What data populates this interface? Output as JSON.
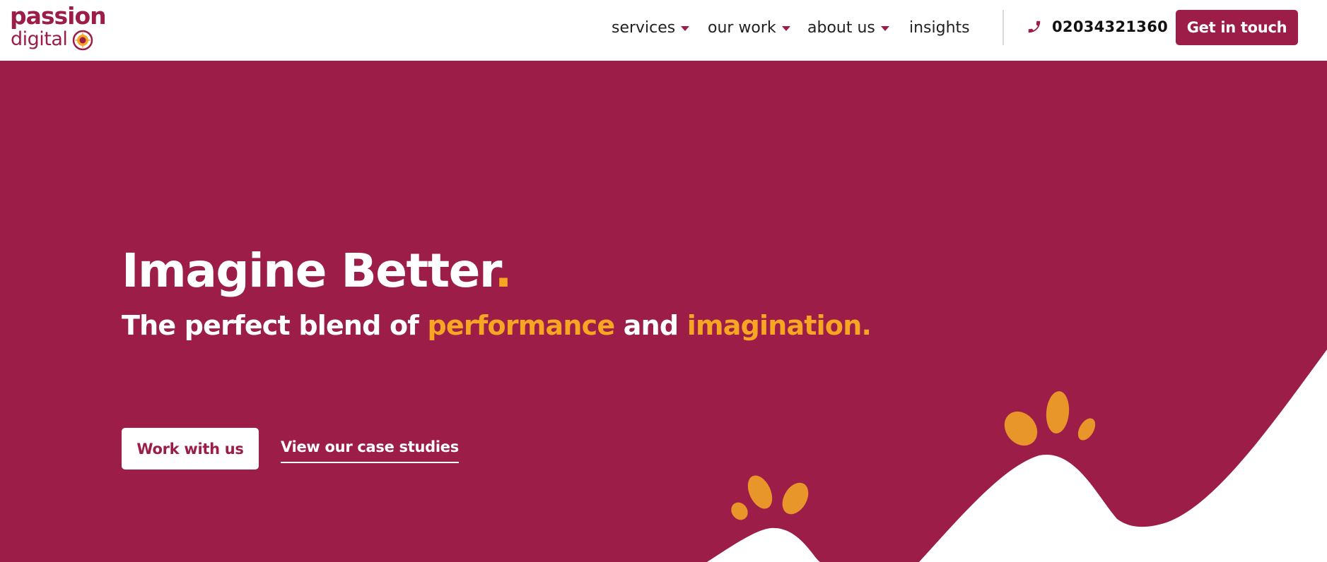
{
  "brand": {
    "logo_top": "passion",
    "logo_bottom": "digital",
    "primary_color": "#9b1d48",
    "accent_color": "#f6a623"
  },
  "nav": {
    "items": [
      {
        "label": "services",
        "has_dropdown": true
      },
      {
        "label": "our work",
        "has_dropdown": true
      },
      {
        "label": "about us",
        "has_dropdown": true
      },
      {
        "label": "insights",
        "has_dropdown": false
      }
    ],
    "phone_icon": "phone-icon",
    "phone": "02034321360",
    "cta_label": "Get in touch"
  },
  "hero": {
    "title": "Imagine Better",
    "title_dot": ".",
    "sub_part1": "The perfect blend of ",
    "sub_highlight1": "performance",
    "sub_part2": " and ",
    "sub_highlight2": "imagination.",
    "primary_button": "Work with us",
    "secondary_link": "View our case studies"
  }
}
